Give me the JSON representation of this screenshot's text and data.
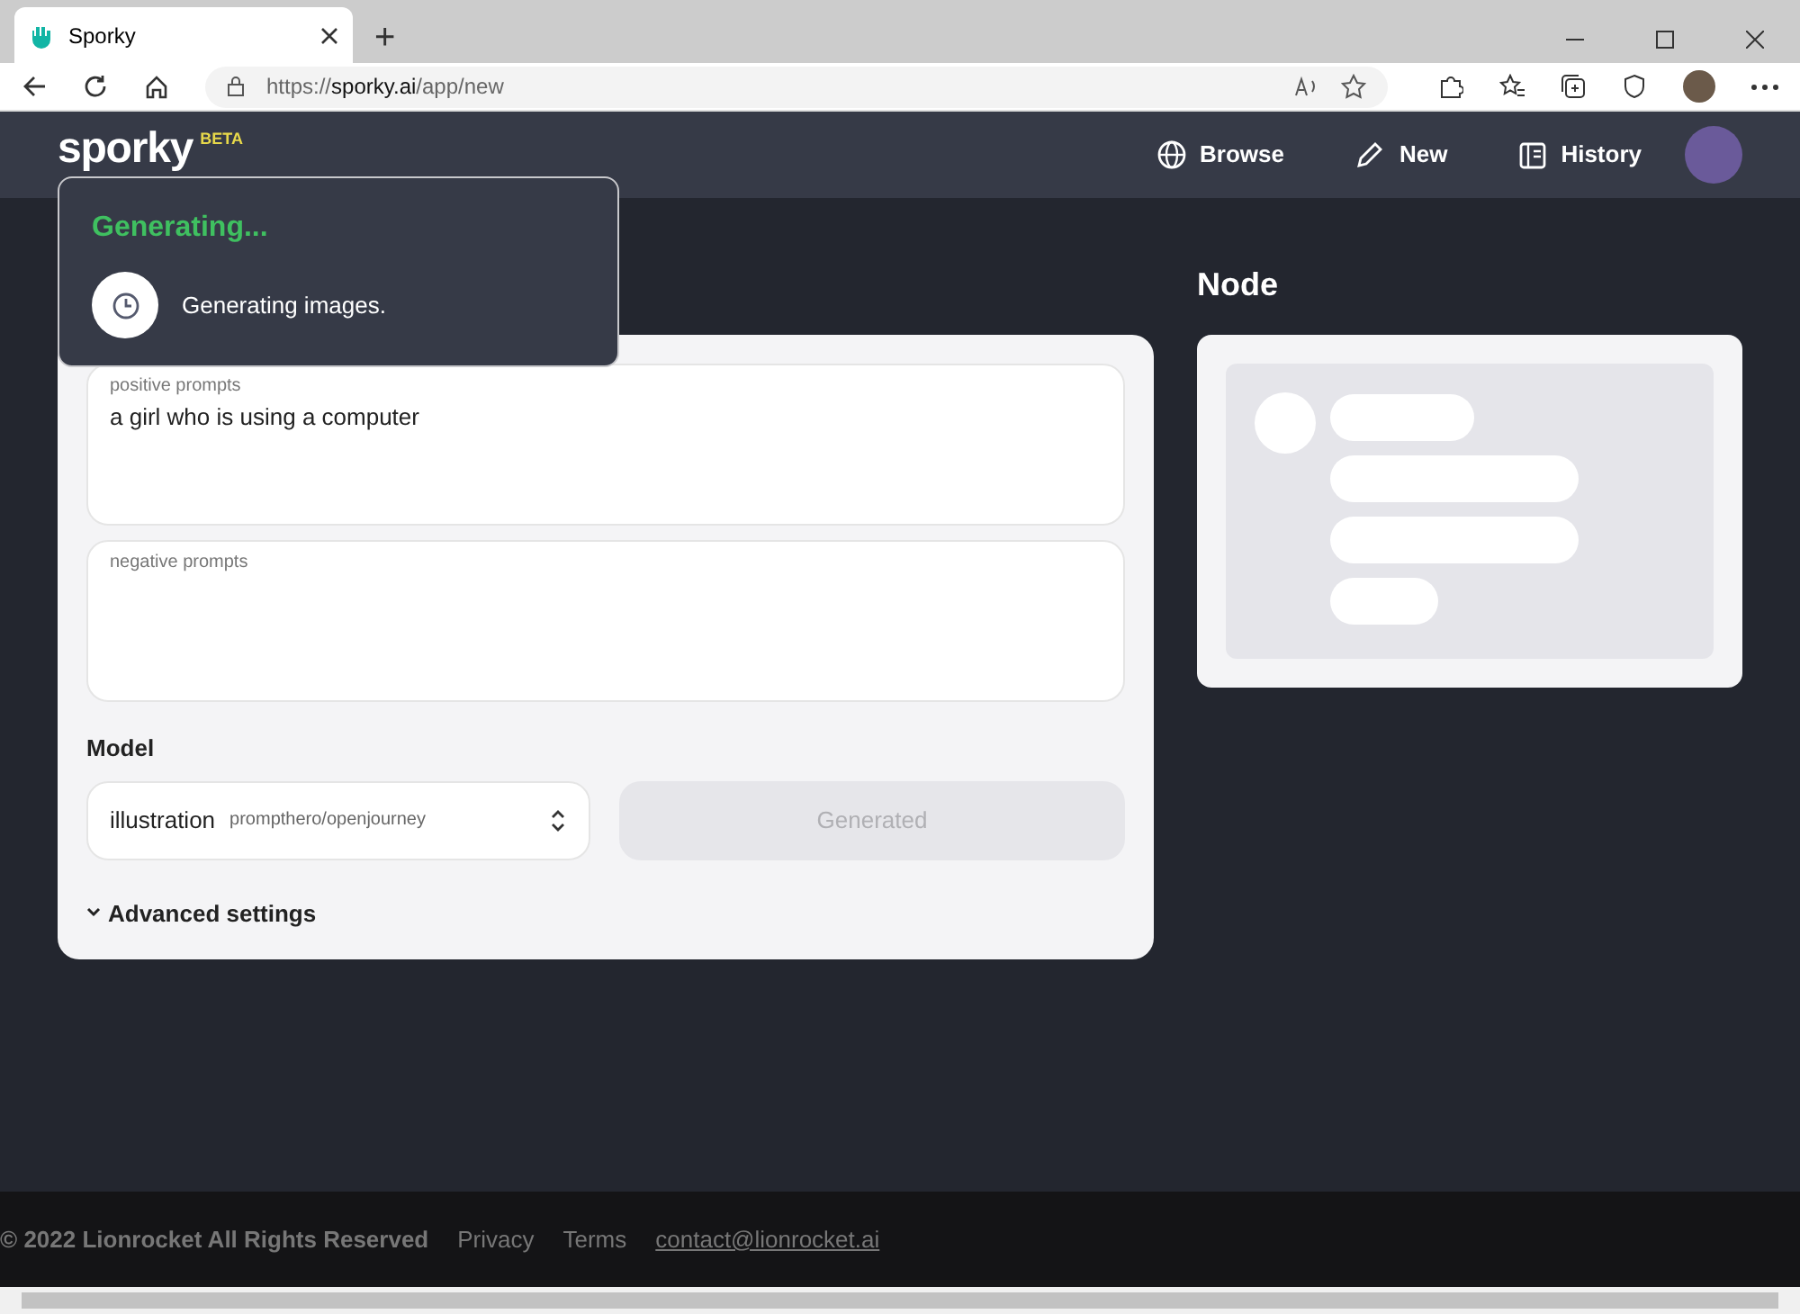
{
  "browser": {
    "tab_title": "Sporky",
    "new_tab": "+",
    "url_prefix": "https://",
    "url_host": "sporky.ai",
    "url_path": "/app/new"
  },
  "header": {
    "logo": "sporky",
    "badge": "BETA",
    "nav": [
      {
        "kind": "globe",
        "label": "Browse"
      },
      {
        "kind": "pencil",
        "label": "New"
      },
      {
        "kind": "book",
        "label": "History"
      }
    ]
  },
  "toast": {
    "title": "Generating...",
    "message": "Generating images."
  },
  "form": {
    "positive": {
      "label": "positive prompts",
      "value": "a girl who is using a computer"
    },
    "negative": {
      "label": "negative prompts"
    },
    "model_label": "Model",
    "model": {
      "name": "illustration",
      "source": "prompthero/openjourney"
    },
    "generate": {
      "label": "Generated",
      "disabled": true
    },
    "advanced": {
      "label": "Advanced settings",
      "expanded": false
    }
  },
  "node": {
    "title": "Node"
  },
  "footer": {
    "copyright": "© 2022 Lionrocket All Rights Reserved",
    "links": [
      "Privacy",
      "Terms"
    ],
    "contact": "contact@lionrocket.ai"
  }
}
